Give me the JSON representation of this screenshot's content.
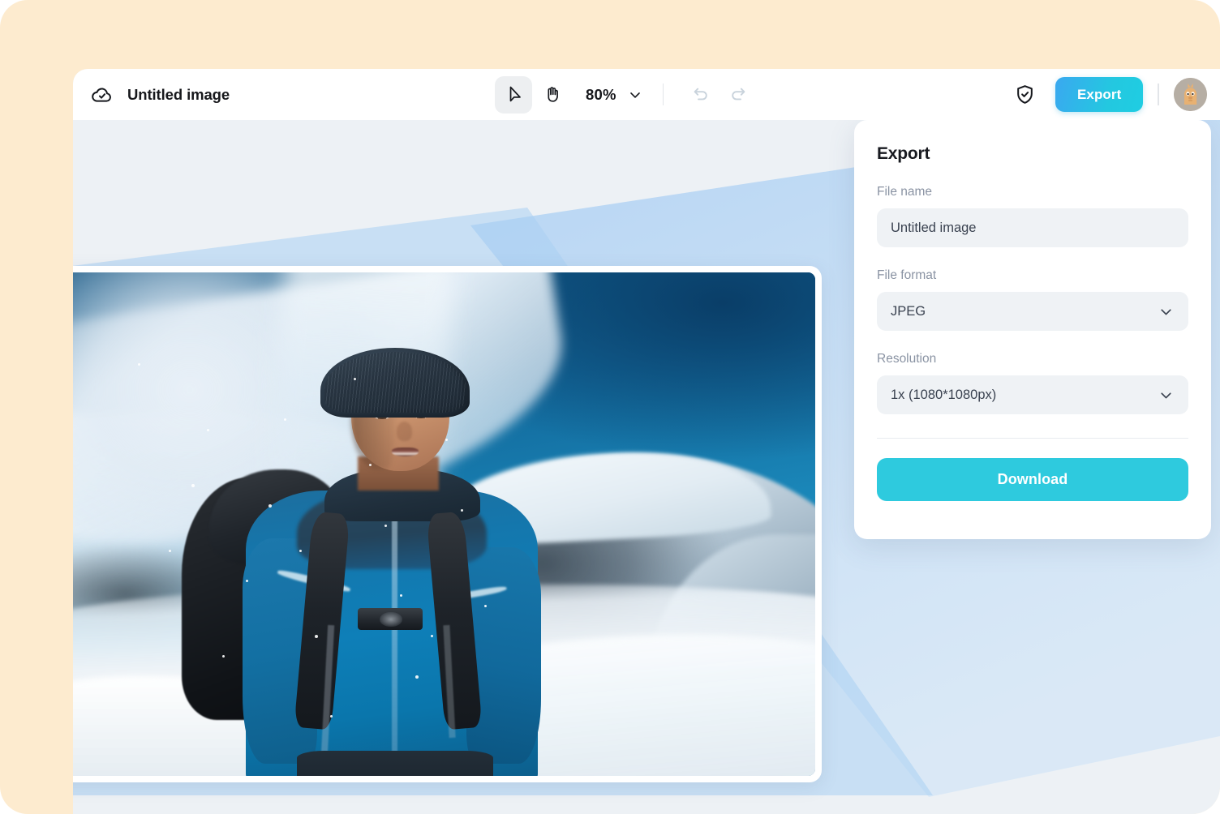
{
  "window": {
    "header": {
      "cloud_icon": "cloud-check-icon",
      "title": "Untitled image",
      "tools": [
        {
          "name": "cursor-tool",
          "icon": "cursor-arrow-icon",
          "active": true
        },
        {
          "name": "hand-tool",
          "icon": "hand-icon",
          "active": false
        }
      ],
      "zoom": {
        "value": "80%",
        "chevron": "chevron-down-icon"
      },
      "history": [
        {
          "name": "undo-button",
          "icon": "undo-arrow-icon",
          "disabled": true
        },
        {
          "name": "redo-button",
          "icon": "redo-arrow-icon",
          "disabled": true
        }
      ],
      "shield_icon": "shield-check-icon",
      "export_label": "Export",
      "avatar": "user-avatar"
    }
  },
  "export_panel": {
    "title": "Export",
    "file_name": {
      "label": "File name",
      "value": "Untitled image",
      "placeholder": "Untitled image"
    },
    "file_format": {
      "label": "File format",
      "value": "JPEG",
      "chevron": "chevron-down-icon"
    },
    "resolution": {
      "label": "Resolution",
      "value": "1x (1080*1080px)",
      "chevron": "chevron-down-icon"
    },
    "download_label": "Download"
  },
  "colors": {
    "backdrop": "#FDEBCF",
    "canvas": "#EDF1F5",
    "accent_cyan": "#2ECADE",
    "export_gradient_start": "#3AA8F0",
    "export_gradient_end": "#1FCDE2",
    "field_bg": "#EFF2F5",
    "beam": "#A9CEF2"
  }
}
